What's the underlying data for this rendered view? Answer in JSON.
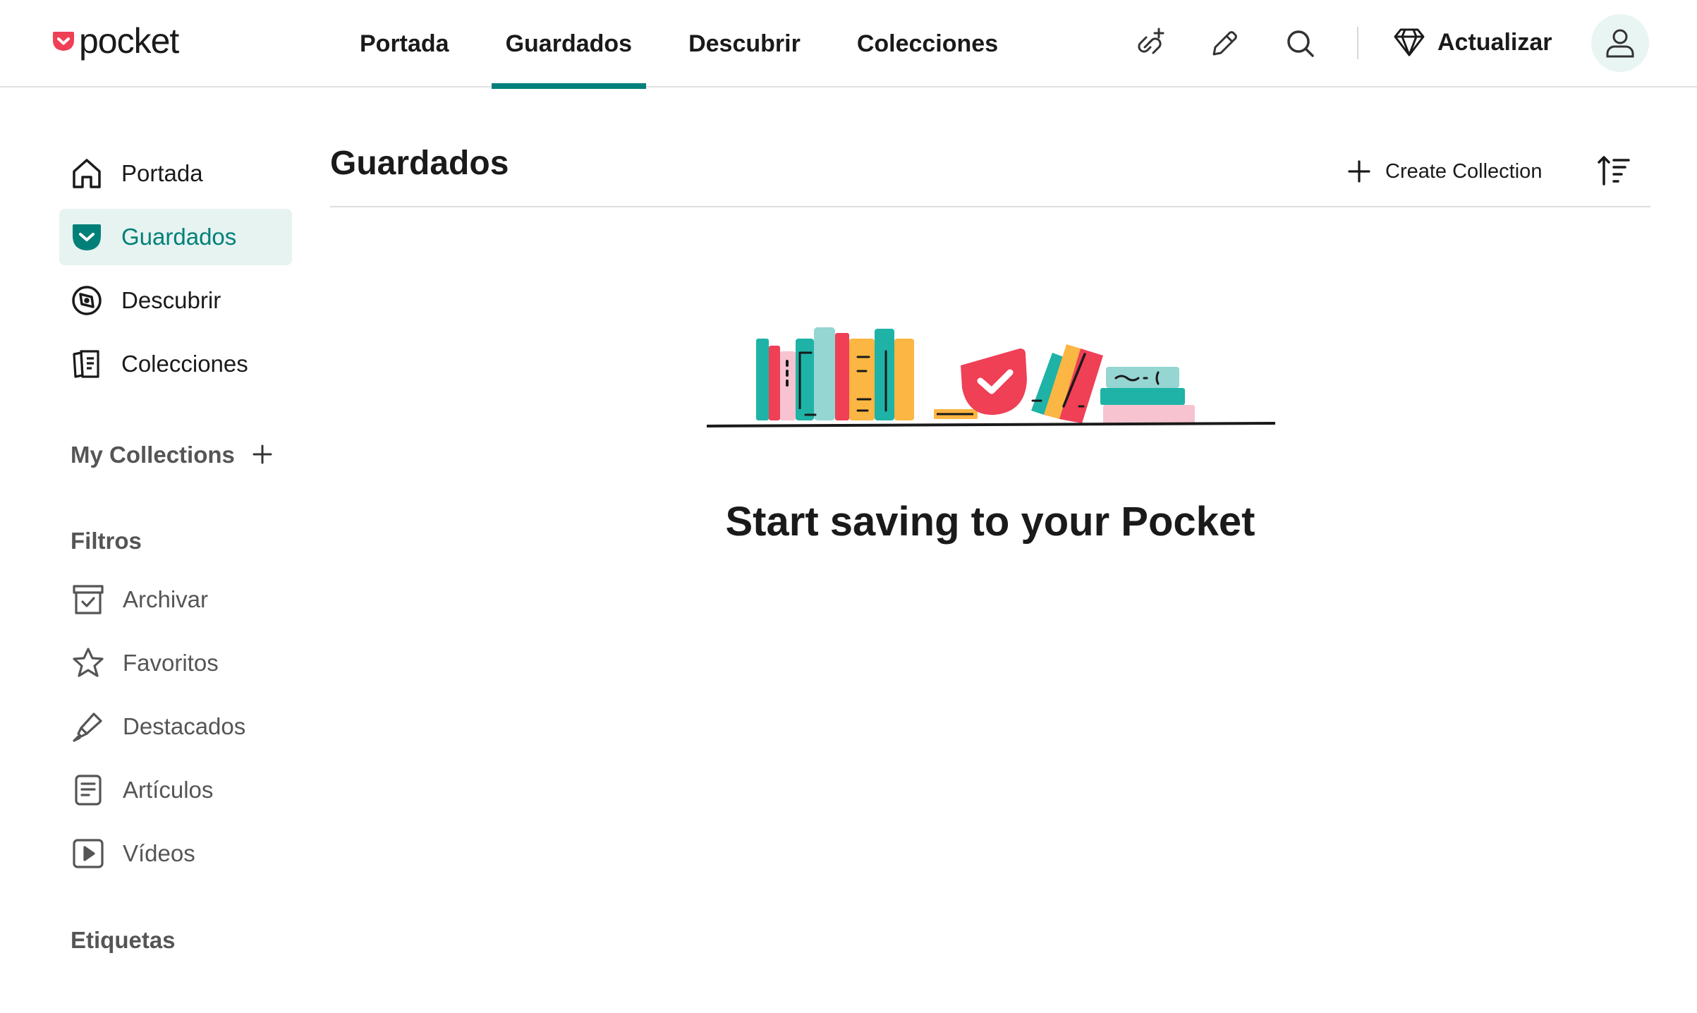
{
  "brand": {
    "name": "pocket",
    "accent_color": "#EF4056",
    "primary_color": "#008078"
  },
  "topnav": {
    "items": [
      {
        "label": "Portada",
        "active": false
      },
      {
        "label": "Guardados",
        "active": true
      },
      {
        "label": "Descubrir",
        "active": false
      },
      {
        "label": "Colecciones",
        "active": false
      }
    ],
    "icons": [
      "add-link-icon",
      "pencil-icon",
      "search-icon"
    ],
    "upgrade_label": "Actualizar",
    "upgrade_icon": "diamond-icon",
    "account_icon": "user-icon"
  },
  "sidebar": {
    "nav": [
      {
        "label": "Portada",
        "icon": "home-icon",
        "active": false
      },
      {
        "label": "Guardados",
        "icon": "pocket-icon",
        "active": true
      },
      {
        "label": "Descubrir",
        "icon": "compass-icon",
        "active": false
      },
      {
        "label": "Colecciones",
        "icon": "collections-icon",
        "active": false
      }
    ],
    "my_collections_label": "My Collections",
    "filters_label": "Filtros",
    "filters": [
      {
        "label": "Archivar",
        "icon": "archive-icon"
      },
      {
        "label": "Favoritos",
        "icon": "star-icon"
      },
      {
        "label": "Destacados",
        "icon": "highlighter-icon"
      },
      {
        "label": "Artículos",
        "icon": "article-icon"
      },
      {
        "label": "Vídeos",
        "icon": "video-icon"
      }
    ],
    "tags_label": "Etiquetas"
  },
  "main": {
    "title": "Guardados",
    "create_collection_label": "Create Collection",
    "sort_icon": "sort-icon",
    "empty_message": "Start saving to your Pocket"
  }
}
